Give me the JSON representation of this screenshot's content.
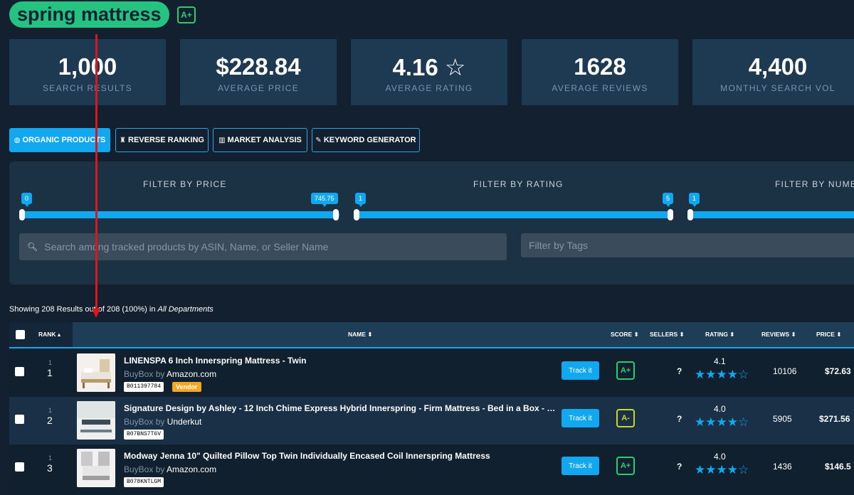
{
  "keyword": {
    "text": "spring mattress",
    "grade": "A+"
  },
  "stats": [
    {
      "value": "1,000",
      "label": "SEARCH RESULTS"
    },
    {
      "value": "$228.84",
      "label": "AVERAGE PRICE"
    },
    {
      "value": "4.16",
      "label": "AVERAGE RATING",
      "icon": "star-outline-icon"
    },
    {
      "value": "1628",
      "label": "AVERAGE REVIEWS"
    },
    {
      "value": "4,400",
      "label": "MONTHLY SEARCH VOL"
    }
  ],
  "tabs": [
    {
      "label": "ORGANIC PRODUCTS",
      "icon": "globe-icon",
      "active": true
    },
    {
      "label": "REVERSE RANKING",
      "icon": "binoculars-icon",
      "active": false
    },
    {
      "label": "MARKET ANALYSIS",
      "icon": "bar-chart-icon",
      "active": false
    },
    {
      "label": "KEYWORD GENERATOR",
      "icon": "magic-wand-icon",
      "active": false
    }
  ],
  "filters": {
    "price": {
      "title": "FILTER BY PRICE",
      "min": "0",
      "max": "745.75"
    },
    "rating": {
      "title": "FILTER BY RATING",
      "min": "1",
      "max": "5"
    },
    "number": {
      "title": "FILTER BY NUMBE",
      "min": "1"
    },
    "search_placeholder": "Search among tracked products by ASIN, Name, or Seller Name",
    "tags_placeholder": "Filter by Tags"
  },
  "results": {
    "prefix": "Showing 208 Results out of 208 (100%) in ",
    "department": "All Departments"
  },
  "columns": {
    "rank": "RANK ▴",
    "name": "NAME ⬍",
    "score": "SCORE ⬍",
    "sellers": "SELLERS ⬍",
    "rating": "RATING ⬍",
    "reviews": "REVIEWS ⬍",
    "price": "PRICE ⬍"
  },
  "rows": [
    {
      "rank_small": "1",
      "rank": "1",
      "name": "LINENSPA 6 Inch Innerspring Mattress - Twin",
      "buybox_label": "BuyBox by ",
      "seller": "Amazon.com",
      "asin": "B011397784",
      "vendor": "Vendor",
      "track_label": "Track it",
      "grade": "A+",
      "sellers": "?",
      "rating": "4.1",
      "stars": "★★★★☆",
      "reviews": "10106",
      "price": "$72.63"
    },
    {
      "rank_small": "1",
      "rank": "2",
      "name": "Signature Design by Ashley - 12 Inch Chime Express Hybrid Innerspring - Firm Mattress - Bed in a Box - Queen...",
      "buybox_label": "BuyBox by ",
      "seller": "Underkut",
      "asin": "B07BNS7T6V",
      "track_label": "Track it",
      "grade": "A-",
      "sellers": "?",
      "rating": "4.0",
      "stars": "★★★★☆",
      "reviews": "5905",
      "price": "$271.56"
    },
    {
      "rank_small": "1",
      "rank": "3",
      "name": "Modway Jenna 10\" Quilted Pillow Top Twin Individually Encased Coil Innerspring Mattress",
      "buybox_label": "BuyBox by ",
      "seller": "Amazon.com",
      "asin": "B078KNTLGM",
      "track_label": "Track it",
      "grade": "A+",
      "sellers": "?",
      "rating": "4.0",
      "stars": "★★★★☆",
      "reviews": "1436",
      "price": "$146.5"
    }
  ],
  "colors": {
    "accent": "#12a8f0",
    "grade_green": "#2ecc71",
    "grade_lime": "#c5d82b",
    "keyword_pill": "#26c281",
    "vendor": "#f5a623",
    "annotation": "#e0151b"
  }
}
